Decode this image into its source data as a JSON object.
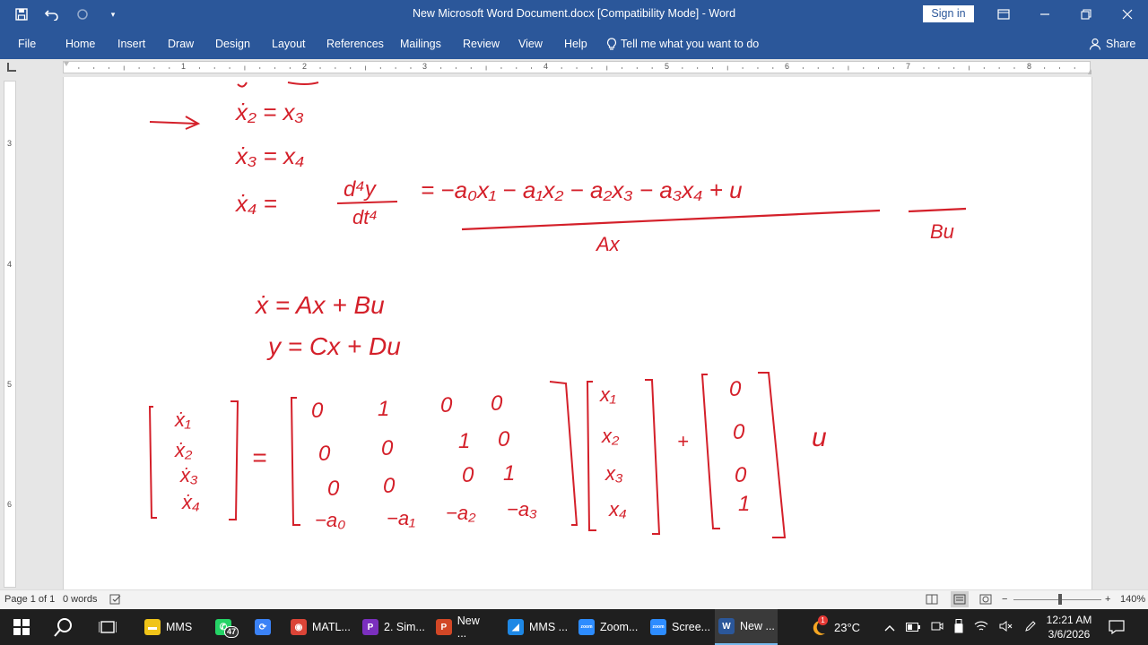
{
  "window": {
    "title": "New Microsoft Word Document.docx [Compatibility Mode]  -  Word",
    "sign_in": "Sign in"
  },
  "menu": {
    "file": "File",
    "home": "Home",
    "insert": "Insert",
    "draw": "Draw",
    "design": "Design",
    "layout": "Layout",
    "references": "References",
    "mailings": "Mailings",
    "review": "Review",
    "view": "View",
    "help": "Help",
    "tell_me": "Tell me what you want to do",
    "share": "Share"
  },
  "ruler": {
    "numbers": [
      "1",
      "2",
      "3",
      "4",
      "5",
      "6",
      "7",
      "8"
    ]
  },
  "vruler": {
    "numbers": [
      "3",
      "4",
      "5",
      "6"
    ]
  },
  "status": {
    "page": "Page 1 of 1",
    "words": "0 words",
    "zoom": "140%"
  },
  "taskbar": {
    "apps": [
      {
        "label": "MMS",
        "icon": "folder-icon",
        "color": "#f0c419"
      },
      {
        "label": "",
        "icon": "whatsapp-icon",
        "color": "#25d366",
        "badge": "47"
      },
      {
        "label": "",
        "icon": "sync-icon",
        "color": "#3b82f6"
      },
      {
        "label": "MATL...",
        "icon": "chrome-icon",
        "color": "#db4437"
      },
      {
        "label": "2. Sim...",
        "icon": "pdf-icon",
        "color": "#7b2fbe"
      },
      {
        "label": "New ...",
        "icon": "powerpoint-icon",
        "color": "#d24726"
      },
      {
        "label": "MMS ...",
        "icon": "simulink-icon",
        "color": "#1e88e5"
      },
      {
        "label": "Zoom...",
        "icon": "zoom-icon",
        "color": "#2d8cff"
      },
      {
        "label": "Scree...",
        "icon": "zoom-icon",
        "color": "#2d8cff"
      },
      {
        "label": "New ...",
        "icon": "word-icon",
        "color": "#2b579a"
      }
    ],
    "weather": "23°C",
    "weather_badge": "1",
    "time": "12:21 AM",
    "date": "3/6/2026"
  },
  "ink": {
    "color": "#d4202a",
    "eq_x2": "ẋ₂ = x₃",
    "eq_x3": "ẋ₃ = x₄",
    "eq_x4_lhs": "ẋ₄ =",
    "eq_x4_frac_num": "d⁴y",
    "eq_x4_frac_den": "dt⁴",
    "eq_x4_rhs": "= −a₀x₁ − a₁x₂ − a₂x₃ − a₃x₄ + u",
    "under_ax": "Ax",
    "under_bu": "Bu",
    "state_eq": "ẋ = Ax + Bu",
    "output_eq": "y = Cx + Du",
    "state_vector": [
      "ẋ₁",
      "ẋ₂",
      "ẋ₃",
      "ẋ₄"
    ],
    "a_matrix": [
      [
        "0",
        "1",
        "0",
        "0"
      ],
      [
        "0",
        "0",
        "1",
        "0"
      ],
      [
        "0",
        "0",
        "0",
        "1"
      ],
      [
        "−a₀",
        "−a₁",
        "−a₂",
        "−a₃"
      ]
    ],
    "x_vector": [
      "x₁",
      "x₂",
      "x₃",
      "x₄"
    ],
    "b_vector": [
      "0",
      "0",
      "0",
      "1"
    ],
    "plus": "+",
    "equals": "=",
    "u": "u"
  }
}
